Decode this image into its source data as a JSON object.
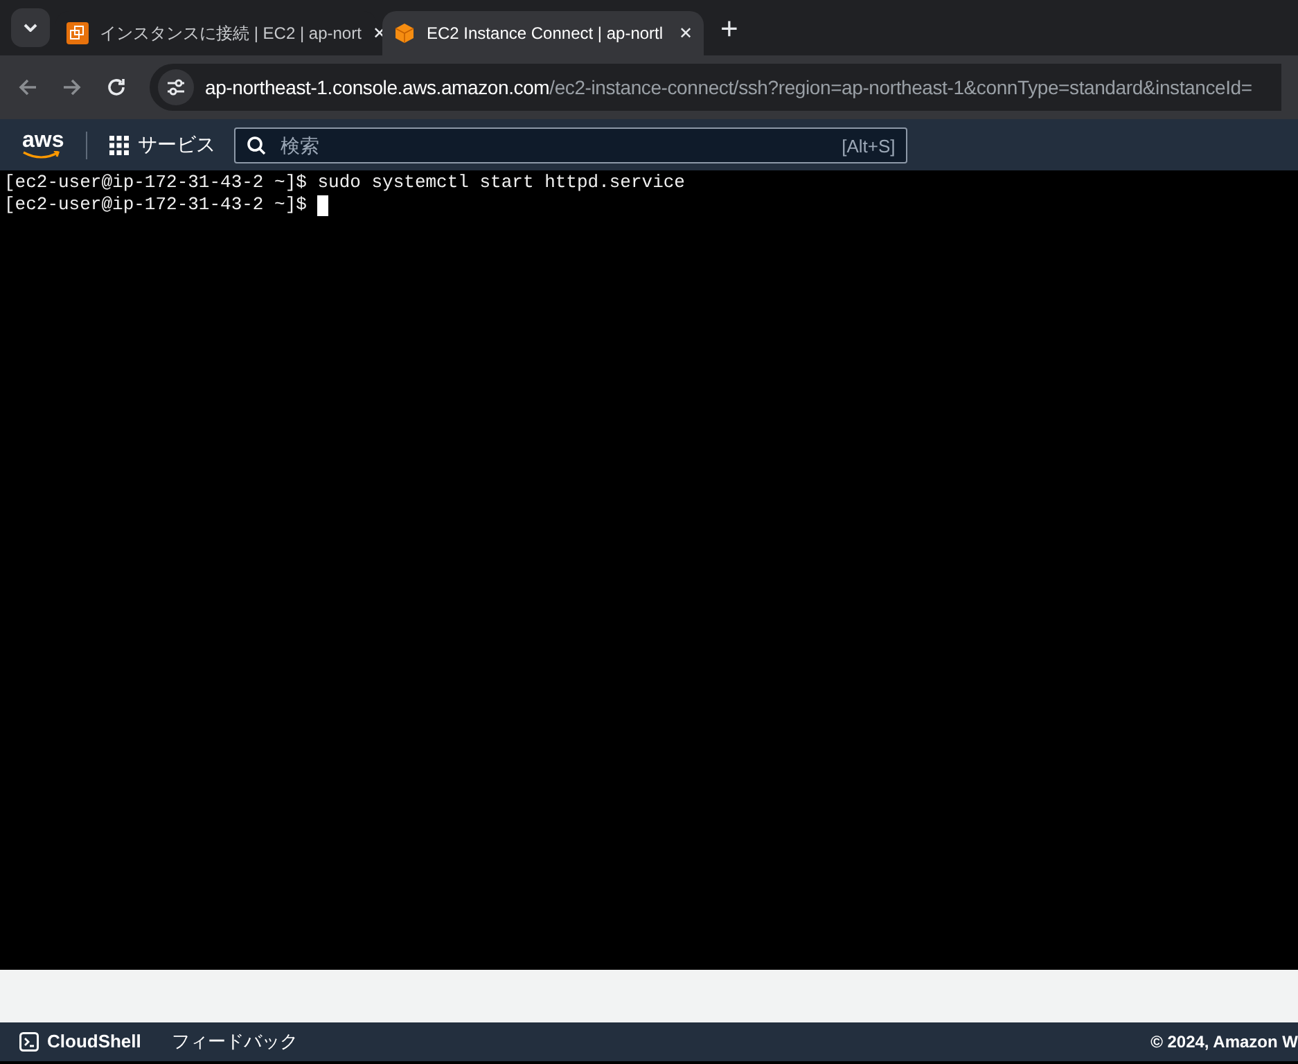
{
  "browser": {
    "tabs": [
      {
        "title": "インスタンスに接続 | EC2 | ap-nort",
        "selected": false,
        "close": "✕"
      },
      {
        "title": "EC2 Instance Connect | ap-nortl",
        "selected": true,
        "close": "✕"
      }
    ],
    "new_tab": "+",
    "url": "ap-northeast-1.console.aws.amazon.com/ec2-instance-connect/ssh?region=ap-northeast-1&connType=standard&instanceId="
  },
  "console_nav": {
    "logo": "aws",
    "services": "サービス",
    "search": {
      "placeholder": "検索",
      "shortcut": "[Alt+S]"
    }
  },
  "terminal": {
    "lines": [
      {
        "prompt": "[ec2-user@ip-172-31-43-2 ~]$",
        "command": "sudo systemctl start httpd.service",
        "cursor": false
      },
      {
        "prompt": "[ec2-user@ip-172-31-43-2 ~]$",
        "cursor": true
      }
    ]
  },
  "footer": {
    "cloudshell": "CloudShell",
    "feedback": "フィードバック",
    "copyright": "© 2024, Amazon W"
  }
}
